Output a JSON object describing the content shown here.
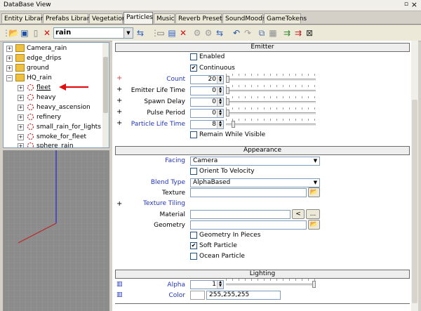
{
  "window": {
    "title": "DataBase View",
    "pin_icon": "pin-icon",
    "close_icon": "close-icon"
  },
  "tabs": [
    {
      "label": "Entity Library"
    },
    {
      "label": "Prefabs Library"
    },
    {
      "label": "Vegetation"
    },
    {
      "label": "Particles",
      "active": true
    },
    {
      "label": "Music"
    },
    {
      "label": "Reverb Presets"
    },
    {
      "label": "SoundMoods"
    },
    {
      "label": "GameTokens"
    }
  ],
  "toolbar": {
    "library_value": "rain"
  },
  "tree": {
    "items": [
      {
        "label": "Camera_rain",
        "kind": "folder"
      },
      {
        "label": "edge_drips",
        "kind": "folder"
      },
      {
        "label": "ground",
        "kind": "folder"
      },
      {
        "label": "HQ_rain",
        "kind": "folder"
      },
      {
        "label": "fleet",
        "kind": "particle",
        "selected": true
      },
      {
        "label": "heavy",
        "kind": "particle"
      },
      {
        "label": "heavy_ascension",
        "kind": "particle"
      },
      {
        "label": "refinery",
        "kind": "particle"
      },
      {
        "label": "small_rain_for_lights",
        "kind": "particle"
      },
      {
        "label": "smoke_for_fleet",
        "kind": "particle"
      },
      {
        "label": "sphere_rain",
        "kind": "particle"
      }
    ]
  },
  "emitter": {
    "header": "Emitter",
    "enabled_label": "Enabled",
    "enabled": false,
    "continuous_label": "Continuous",
    "continuous": true,
    "count_label": "Count",
    "count": "20",
    "emitter_life_label": "Emitter Life Time",
    "emitter_life": "0",
    "spawn_delay_label": "Spawn Delay",
    "spawn_delay": "0",
    "pulse_period_label": "Pulse Period",
    "pulse_period": "0",
    "particle_life_label": "Particle Life Time",
    "particle_life": "8",
    "remain_label": "Remain While Visible",
    "remain": false
  },
  "appearance": {
    "header": "Appearance",
    "facing_label": "Facing",
    "facing": "Camera",
    "orient_label": "Orient To Velocity",
    "orient": false,
    "blend_label": "Blend Type",
    "blend": "AlphaBased",
    "texture_label": "Texture",
    "texture": "",
    "tiling_label": "Texture Tiling",
    "material_label": "Material",
    "material": "",
    "material_back_label": "<",
    "material_browse_label": "...",
    "geometry_label": "Geometry",
    "geometry": "",
    "geo_pieces_label": "Geometry In Pieces",
    "geo_pieces": false,
    "soft_label": "Soft Particle",
    "soft": true,
    "ocean_label": "Ocean Particle",
    "ocean": false
  },
  "lighting": {
    "header": "Lighting",
    "alpha_label": "Alpha",
    "alpha": "1",
    "color_label": "Color",
    "color": "255,255,255"
  },
  "colors": {
    "label_blue": "#2233c0",
    "arrow_red": "#e01010",
    "axis_blue": "#1010e0",
    "axis_red": "#c02020"
  }
}
